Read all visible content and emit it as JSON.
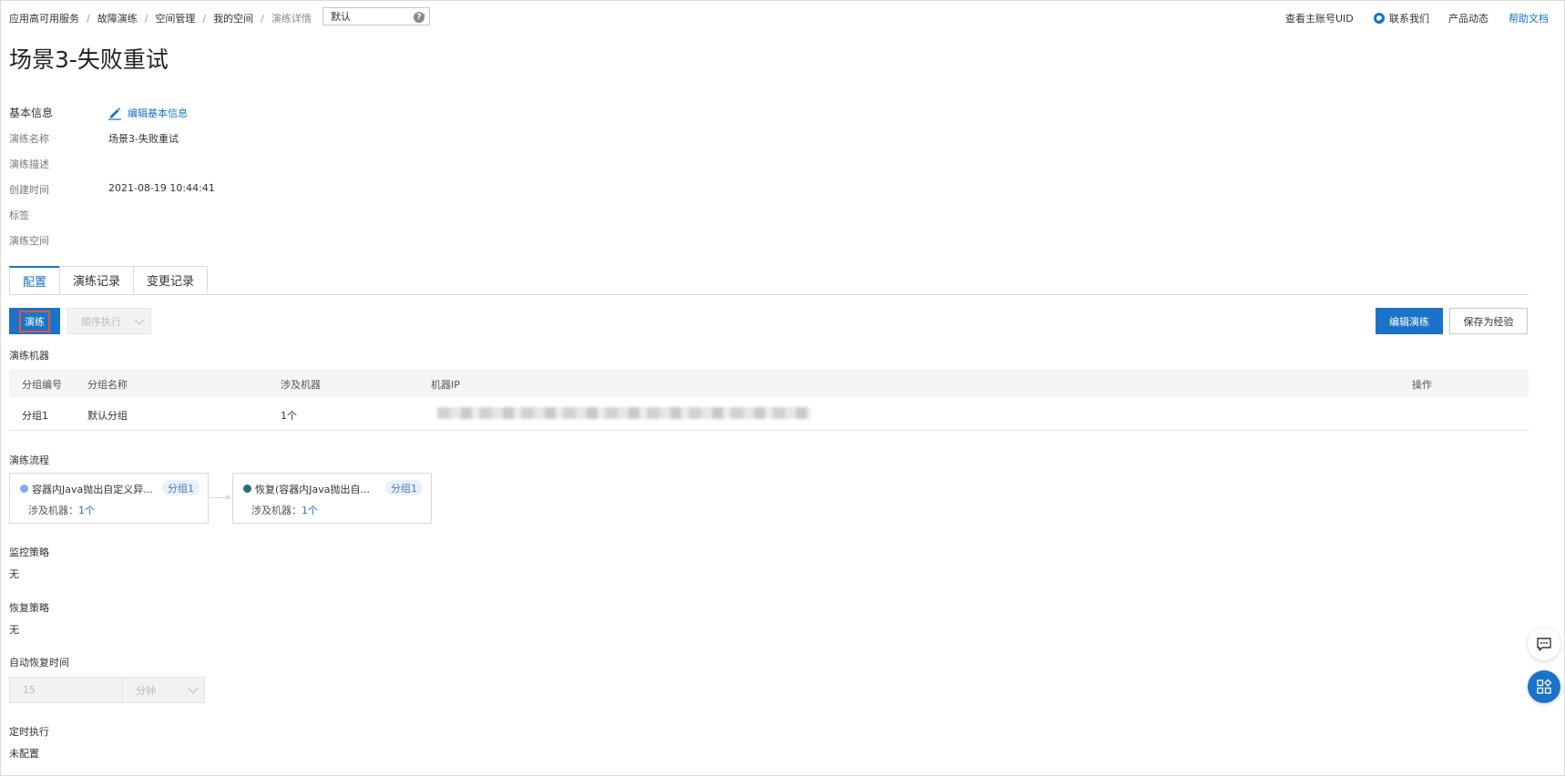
{
  "breadcrumb": [
    {
      "label": "应用高可用服务"
    },
    {
      "label": "故障演练"
    },
    {
      "label": "空间管理"
    },
    {
      "label": "我的空间"
    },
    {
      "label": "演练详情"
    }
  ],
  "workspace_select": {
    "value": "默认"
  },
  "top_links": {
    "uid": "查看主账号UID",
    "contact": "联系我们",
    "news": "产品动态",
    "help": "帮助文档"
  },
  "page_title": "场景3-失败重试",
  "basic_info": {
    "title": "基本信息",
    "edit_label": "编辑基本信息",
    "fields": [
      {
        "key": "演练名称",
        "value": "场景3-失败重试"
      },
      {
        "key": "演练描述",
        "value": ""
      },
      {
        "key": "创建时间",
        "value": "2021-08-19 10:44:41"
      },
      {
        "key": "标签",
        "value": ""
      },
      {
        "key": "演练空间",
        "value": ""
      }
    ]
  },
  "tabs": [
    {
      "label": "配置",
      "active": true
    },
    {
      "label": "演练记录",
      "active": false
    },
    {
      "label": "变更记录",
      "active": false
    }
  ],
  "actions": {
    "drill": "演练",
    "exec_mode": "顺序执行",
    "edit_drill": "编辑演练",
    "save_experience": "保存为经验"
  },
  "machines": {
    "title": "演练机器",
    "columns": [
      "分组编号",
      "分组名称",
      "涉及机器",
      "机器IP",
      "操作"
    ],
    "rows": [
      {
        "group_id": "分组1",
        "group_name": "默认分组",
        "machines": "1个",
        "ip": "",
        "ops": ""
      }
    ]
  },
  "flow": {
    "title": "演练流程",
    "nodes": [
      {
        "title": "容器内Java抛出自定义异...",
        "tag": "分组1",
        "machines_label": "涉及机器：",
        "machines_value": "1个",
        "dot_color": "#7eaee8"
      },
      {
        "title": "恢复(容器内Java抛出自...",
        "tag": "分组1",
        "machines_label": "涉及机器：",
        "machines_value": "1个",
        "dot_color": "#2e6b78"
      }
    ]
  },
  "monitor": {
    "label": "监控策略",
    "value": "无"
  },
  "recovery": {
    "label": "恢复策略",
    "value": "无"
  },
  "auto_recover": {
    "label": "自动恢复时间",
    "value": "15",
    "unit": "分钟"
  },
  "schedule": {
    "label": "定时执行",
    "value": "未配置"
  },
  "colors": {
    "primary": "#1a73c9",
    "highlight": "#e4572e"
  }
}
